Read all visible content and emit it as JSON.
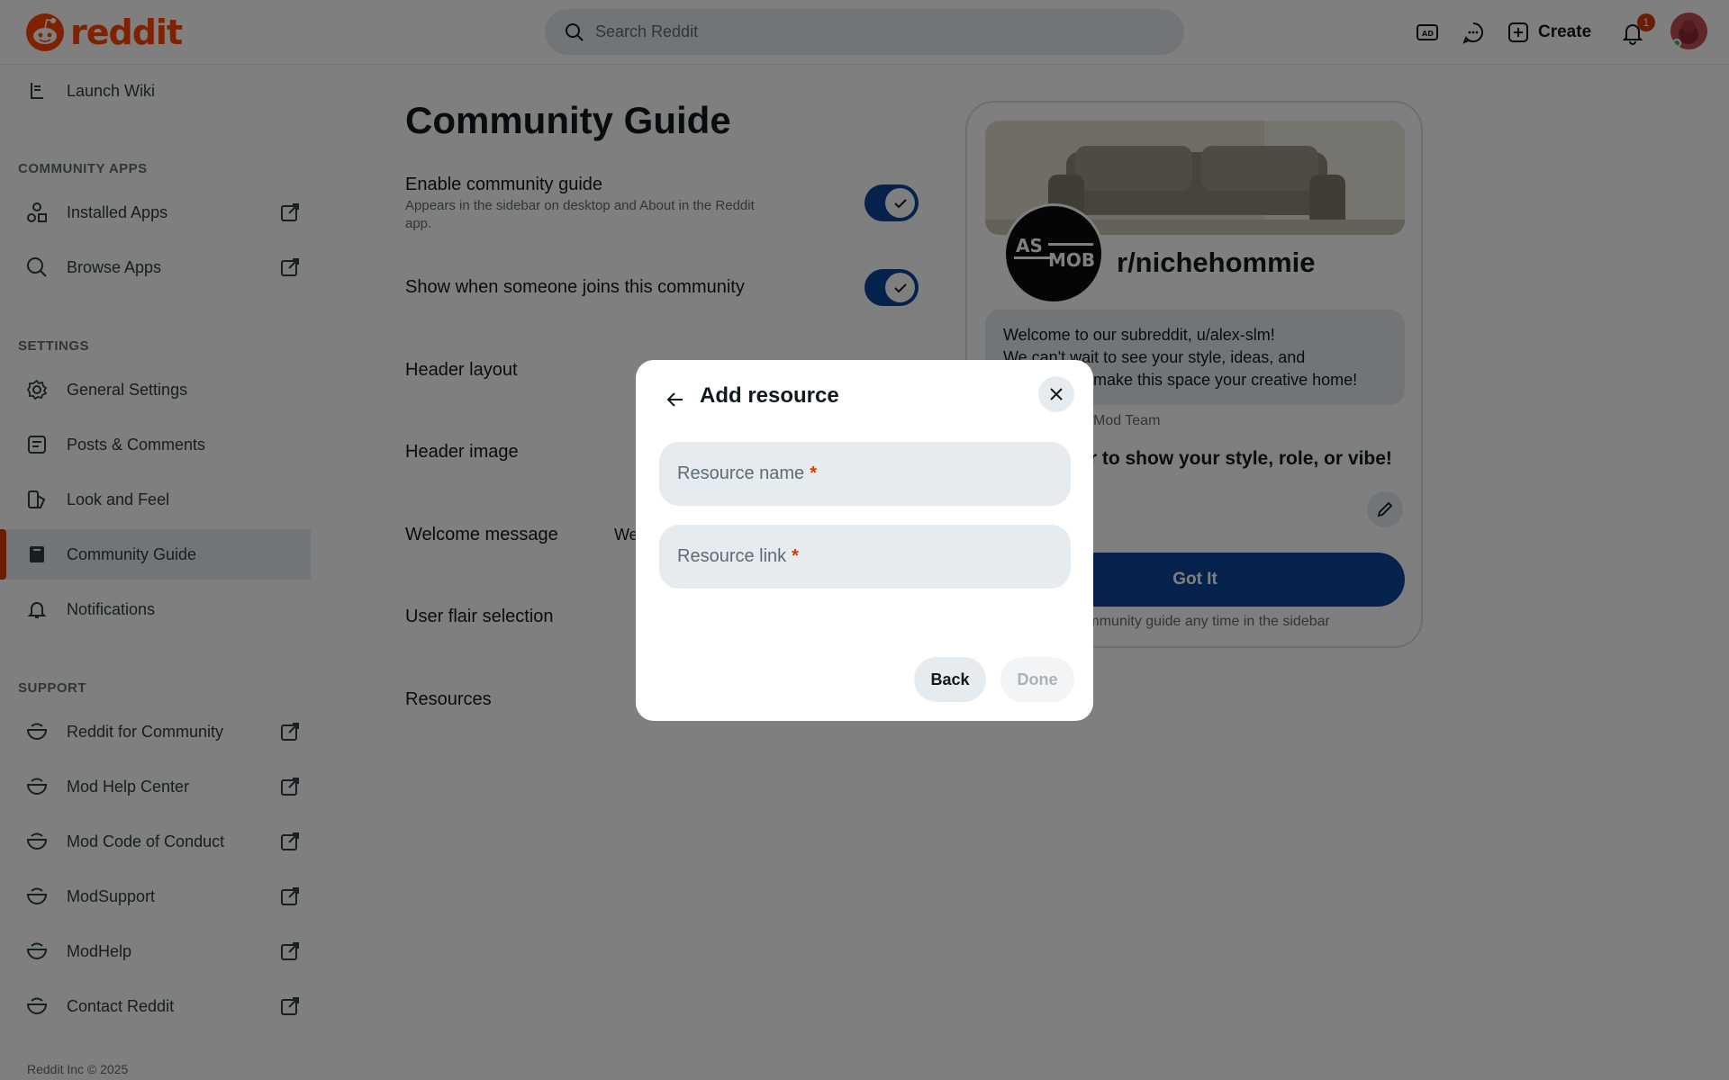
{
  "header": {
    "logo_text": "reddit",
    "search_placeholder": "Search Reddit",
    "create_label": "Create",
    "notification_count": "1",
    "icons": [
      "advertise-icon",
      "chat-icon",
      "create-icon",
      "bell-icon"
    ]
  },
  "sidebar": {
    "launch_wiki": "Launch Wiki",
    "community_apps_title": "COMMUNITY APPS",
    "installed_apps": "Installed Apps",
    "browse_apps": "Browse Apps",
    "settings_title": "SETTINGS",
    "general_settings": "General Settings",
    "posts_comments": "Posts & Comments",
    "look_and_feel": "Look and Feel",
    "community_guide": "Community Guide",
    "notifications": "Notifications",
    "support_title": "SUPPORT",
    "reddit_for_community": "Reddit for Community",
    "mod_help_center": "Mod Help Center",
    "mod_code_of_conduct": "Mod Code of Conduct",
    "modsupport": "ModSupport",
    "modhelp": "ModHelp",
    "contact_reddit": "Contact Reddit",
    "footer": "Reddit Inc © 2025"
  },
  "main": {
    "title": "Community Guide",
    "enable_guide_label": "Enable community guide",
    "enable_guide_desc": "Appears in the sidebar on desktop and About in the Reddit app.",
    "show_joins_label": "Show when someone joins this community",
    "header_layout": "Header layout",
    "header_image": "Header image",
    "welcome_message": "Welcome message",
    "welcome_fragment": "We",
    "user_flair_selection": "User flair selection",
    "resources": "Resources"
  },
  "preview": {
    "avatar_text_top": "AS",
    "avatar_text_bottom": "MOB",
    "community_name": "r/nichehommie",
    "welcome_line1": "Welcome to our subreddit, u/alex-slm!",
    "welcome_line2": "We can't wait to see your style, ideas, and",
    "welcome_line3": "make this space your creative home!",
    "mod_team": "Mod Team",
    "flair_prompt": "ir to show your style, role, or vibe!",
    "got_it": "Got It",
    "footer_text": "e community guide any time in the sidebar"
  },
  "modal": {
    "title": "Add resource",
    "resource_name_placeholder": "Resource name",
    "resource_link_placeholder": "Resource link",
    "required_mark": "*",
    "back_label": "Back",
    "done_label": "Done"
  },
  "colors": {
    "brand": "#ff4500",
    "toggle_on": "#0a449b",
    "active_indicator": "#d93900"
  }
}
